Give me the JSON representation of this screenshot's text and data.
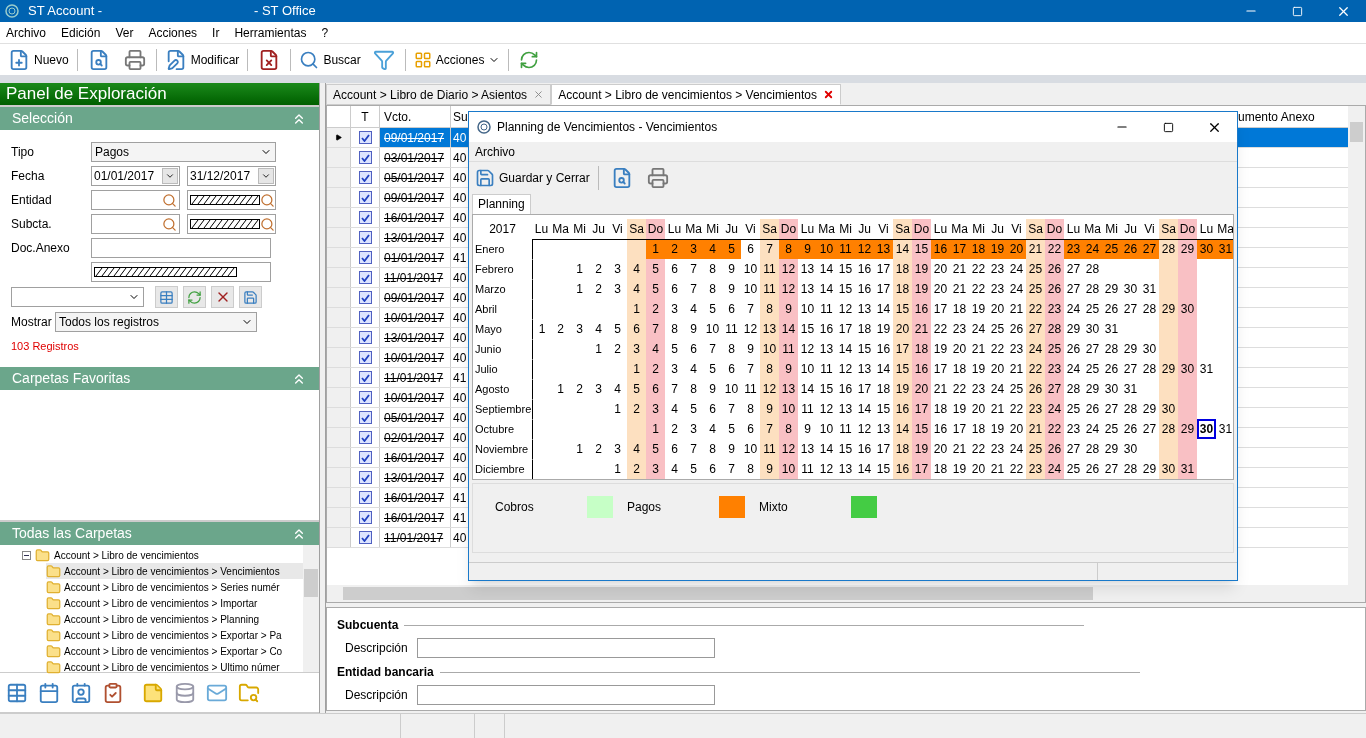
{
  "window": {
    "title_left": "ST Account -",
    "title_right": "- ST Office"
  },
  "menu": [
    "Archivo",
    "Edición",
    "Ver",
    "Acciones",
    "Ir",
    "Herramientas",
    "?"
  ],
  "toolbar": {
    "new": "Nuevo",
    "modify": "Modificar",
    "search": "Buscar",
    "actions": "Acciones"
  },
  "explorer": {
    "title": "Panel de Exploración",
    "selection": {
      "title": "Selección",
      "tipo": {
        "label": "Tipo",
        "value": "Pagos"
      },
      "fecha": {
        "label": "Fecha",
        "from": "01/01/2017",
        "to": "31/12/2017"
      },
      "entidad": {
        "label": "Entidad",
        "masked": true
      },
      "subcuenta": {
        "label": "Subcta.",
        "masked": true
      },
      "doc_anexo": {
        "label": "Doc.Anexo",
        "masked": true
      },
      "mostrar": {
        "label": "Mostrar",
        "value": "Todos los registros"
      },
      "count": "103 Registros"
    },
    "favorites": {
      "title": "Carpetas Favoritas"
    },
    "folders": {
      "title": "Todas las Carpetas",
      "tree": [
        {
          "label": "Account > Libro de vencimientos",
          "expanded": true,
          "selected": false,
          "children": [
            {
              "label": "Account > Libro de vencimientos > Vencimientos",
              "selected": true
            },
            {
              "label": "Account > Libro de vencimientos > Series numér",
              "selected": false
            },
            {
              "label": "Account > Libro de vencimientos > Importar",
              "selected": false
            },
            {
              "label": "Account > Libro de vencimientos > Planning",
              "selected": false
            },
            {
              "label": "Account > Libro de vencimientos > Exportar > Pa",
              "selected": false
            },
            {
              "label": "Account > Libro de vencimientos > Exportar > Co",
              "selected": false
            },
            {
              "label": "Account > Libro de vencimientos > Ultimo númer",
              "selected": false
            }
          ]
        }
      ]
    }
  },
  "tabs": [
    {
      "label": "Account > Libro de Diario > Asientos",
      "selected": false
    },
    {
      "label": "Account > Libro de vencimientos > Vencimientos",
      "selected": true
    }
  ],
  "table": {
    "columns": [
      "T",
      "Vcto.",
      "Su",
      "umento Anexo"
    ],
    "rows": [
      {
        "selected": true,
        "checked": true,
        "struck": true,
        "vcto": "09/01/2017",
        "su": "40"
      },
      {
        "selected": false,
        "checked": true,
        "struck": true,
        "vcto": "03/01/2017",
        "su": "40"
      },
      {
        "selected": false,
        "checked": true,
        "struck": true,
        "vcto": "05/01/2017",
        "su": "40"
      },
      {
        "selected": false,
        "checked": true,
        "struck": true,
        "vcto": "09/01/2017",
        "su": "40"
      },
      {
        "selected": false,
        "checked": true,
        "struck": true,
        "vcto": "16/01/2017",
        "su": "40"
      },
      {
        "selected": false,
        "checked": true,
        "struck": true,
        "vcto": "13/01/2017",
        "su": "40"
      },
      {
        "selected": false,
        "checked": true,
        "struck": true,
        "vcto": "01/01/2017",
        "su": "41"
      },
      {
        "selected": false,
        "checked": true,
        "struck": true,
        "vcto": "11/01/2017",
        "su": "40"
      },
      {
        "selected": false,
        "checked": true,
        "struck": true,
        "vcto": "09/01/2017",
        "su": "40"
      },
      {
        "selected": false,
        "checked": true,
        "struck": true,
        "vcto": "10/01/2017",
        "su": "40"
      },
      {
        "selected": false,
        "checked": true,
        "struck": true,
        "vcto": "13/01/2017",
        "su": "40"
      },
      {
        "selected": false,
        "checked": true,
        "struck": true,
        "vcto": "10/01/2017",
        "su": "40"
      },
      {
        "selected": false,
        "checked": true,
        "struck": true,
        "vcto": "11/01/2017",
        "su": "41"
      },
      {
        "selected": false,
        "checked": true,
        "struck": true,
        "vcto": "10/01/2017",
        "su": "40"
      },
      {
        "selected": false,
        "checked": true,
        "struck": true,
        "vcto": "05/01/2017",
        "su": "40"
      },
      {
        "selected": false,
        "checked": true,
        "struck": true,
        "vcto": "02/01/2017",
        "su": "40"
      },
      {
        "selected": false,
        "checked": true,
        "struck": true,
        "vcto": "16/01/2017",
        "su": "40"
      },
      {
        "selected": false,
        "checked": true,
        "struck": true,
        "vcto": "13/01/2017",
        "su": "40"
      },
      {
        "selected": false,
        "checked": true,
        "struck": true,
        "vcto": "16/01/2017",
        "su": "41"
      },
      {
        "selected": false,
        "checked": true,
        "struck": true,
        "vcto": "16/01/2017",
        "su": "41"
      },
      {
        "selected": false,
        "checked": true,
        "struck": true,
        "vcto": "11/01/2017",
        "su": "40"
      }
    ]
  },
  "details": [
    {
      "title": "Subcuenta",
      "label": "Descripción"
    },
    {
      "title": "Entidad bancaria",
      "label": "Descripción"
    }
  ],
  "dialog": {
    "title": "Planning de Vencimientos - Vencimientos",
    "menu": [
      "Archivo"
    ],
    "save": "Guardar y Cerrar",
    "tab": "Planning",
    "calendar": {
      "year": "2017",
      "weekdays": [
        {
          "label": "Lu",
          "kind": "work"
        },
        {
          "label": "Ma",
          "kind": "work"
        },
        {
          "label": "Mi",
          "kind": "work"
        },
        {
          "label": "Ju",
          "kind": "work"
        },
        {
          "label": "Vi",
          "kind": "work"
        },
        {
          "label": "Sa",
          "kind": "sat"
        },
        {
          "label": "Do",
          "kind": "sun"
        },
        {
          "label": "Lu",
          "kind": "work"
        },
        {
          "label": "Ma",
          "kind": "work"
        },
        {
          "label": "Mi",
          "kind": "work"
        },
        {
          "label": "Ju",
          "kind": "work"
        },
        {
          "label": "Vi",
          "kind": "work"
        },
        {
          "label": "Sa",
          "kind": "sat"
        },
        {
          "label": "Do",
          "kind": "sun"
        },
        {
          "label": "Lu",
          "kind": "work"
        },
        {
          "label": "Ma",
          "kind": "work"
        },
        {
          "label": "Mi",
          "kind": "work"
        },
        {
          "label": "Ju",
          "kind": "work"
        },
        {
          "label": "Vi",
          "kind": "work"
        },
        {
          "label": "Sa",
          "kind": "sat"
        },
        {
          "label": "Do",
          "kind": "sun"
        },
        {
          "label": "Lu",
          "kind": "work"
        },
        {
          "label": "Ma",
          "kind": "work"
        },
        {
          "label": "Mi",
          "kind": "work"
        },
        {
          "label": "Ju",
          "kind": "work"
        },
        {
          "label": "Vi",
          "kind": "work"
        },
        {
          "label": "Sa",
          "kind": "sat"
        },
        {
          "label": "Do",
          "kind": "sun"
        },
        {
          "label": "Lu",
          "kind": "work"
        },
        {
          "label": "Ma",
          "kind": "work"
        },
        {
          "label": "Mi",
          "kind": "work"
        },
        {
          "label": "Ju",
          "kind": "work"
        },
        {
          "label": "Vi",
          "kind": "work"
        },
        {
          "label": "Sa",
          "kind": "sat"
        },
        {
          "label": "Do",
          "kind": "sun"
        },
        {
          "label": "Lu",
          "kind": "work"
        },
        {
          "label": "Ma",
          "kind": "work"
        }
      ],
      "months": [
        {
          "name": "Enero",
          "kind": "sun",
          "days": [
            {
              "day": "1",
              "kind": "pagos",
              "selected": false
            },
            {
              "day": "2",
              "kind": "pagos",
              "selected": false
            },
            {
              "day": "3",
              "kind": "pagos",
              "selected": false
            },
            {
              "day": "4",
              "kind": "pagos",
              "selected": false
            },
            {
              "day": "5",
              "kind": "pagos",
              "selected": false
            },
            "6",
            "7",
            {
              "day": "8",
              "kind": "pagos",
              "selected": false
            },
            {
              "day": "9",
              "kind": "pagos",
              "selected": false
            },
            {
              "day": "10",
              "kind": "pagos",
              "selected": false
            },
            {
              "day": "11",
              "kind": "pagos",
              "selected": false
            },
            {
              "day": "12",
              "kind": "pagos",
              "selected": false
            },
            {
              "day": "13",
              "kind": "pagos",
              "selected": false
            },
            "14",
            "15",
            {
              "day": "16",
              "kind": "pagos",
              "selected": false
            },
            {
              "day": "17",
              "kind": "pagos",
              "selected": false
            },
            {
              "day": "18",
              "kind": "pagos",
              "selected": false
            },
            {
              "day": "19",
              "kind": "pagos",
              "selected": false
            },
            {
              "day": "20",
              "kind": "pagos",
              "selected": false
            },
            "21",
            "22",
            {
              "day": "23",
              "kind": "pagos",
              "selected": false
            },
            {
              "day": "24",
              "kind": "pagos",
              "selected": false
            },
            {
              "day": "25",
              "kind": "pagos",
              "selected": false
            },
            {
              "day": "26",
              "kind": "pagos",
              "selected": false
            },
            {
              "day": "27",
              "kind": "pagos",
              "selected": false
            },
            "28",
            "29",
            {
              "day": "30",
              "kind": "pagos",
              "selected": false
            },
            {
              "day": "31",
              "kind": "pagos",
              "selected": false
            }
          ]
        },
        {
          "name": "Febrero",
          "kind": "wed",
          "days": [
            "1",
            "2",
            "3",
            "4",
            "5",
            "6",
            "7",
            "8",
            "9",
            "10",
            "11",
            "12",
            "13",
            "14",
            "15",
            "16",
            "17",
            "18",
            "19",
            "20",
            "21",
            "22",
            "23",
            "24",
            "25",
            "26",
            "27",
            "28"
          ]
        },
        {
          "name": "Marzo",
          "kind": "wed",
          "days": [
            "1",
            "2",
            "3",
            "4",
            "5",
            "6",
            "7",
            "8",
            "9",
            "10",
            "11",
            "12",
            "13",
            "14",
            "15",
            "16",
            "17",
            "18",
            "19",
            "20",
            "21",
            "22",
            "23",
            "24",
            "25",
            "26",
            "27",
            "28",
            "29",
            "30",
            "31"
          ]
        },
        {
          "name": "Abril",
          "kind": "sat",
          "days": [
            "1",
            "2",
            "3",
            "4",
            "5",
            "6",
            "7",
            "8",
            "9",
            "10",
            "11",
            "12",
            "13",
            "14",
            "15",
            "16",
            "17",
            "18",
            "19",
            "20",
            "21",
            "22",
            "23",
            "24",
            "25",
            "26",
            "27",
            "28",
            "29",
            "30"
          ]
        },
        {
          "name": "Mayo",
          "kind": "mon",
          "days": [
            "1",
            "2",
            "3",
            "4",
            "5",
            "6",
            "7",
            "8",
            "9",
            "10",
            "11",
            "12",
            "13",
            "14",
            "15",
            "16",
            "17",
            "18",
            "19",
            "20",
            "21",
            "22",
            "23",
            "24",
            "25",
            "26",
            "27",
            "28",
            "29",
            "30",
            "31"
          ]
        },
        {
          "name": "Junio",
          "kind": "thu",
          "days": [
            "1",
            "2",
            "3",
            "4",
            "5",
            "6",
            "7",
            "8",
            "9",
            "10",
            "11",
            "12",
            "13",
            "14",
            "15",
            "16",
            "17",
            "18",
            "19",
            "20",
            "21",
            "22",
            "23",
            "24",
            "25",
            "26",
            "27",
            "28",
            "29",
            "30"
          ]
        },
        {
          "name": "Julio",
          "kind": "sat",
          "days": [
            "1",
            "2",
            "3",
            "4",
            "5",
            "6",
            "7",
            "8",
            "9",
            "10",
            "11",
            "12",
            "13",
            "14",
            "15",
            "16",
            "17",
            "18",
            "19",
            "20",
            "21",
            "22",
            "23",
            "24",
            "25",
            "26",
            "27",
            "28",
            "29",
            "30",
            "31"
          ]
        },
        {
          "name": "Agosto",
          "kind": "tue",
          "days": [
            "1",
            "2",
            "3",
            "4",
            "5",
            "6",
            "7",
            "8",
            "9",
            "10",
            "11",
            "12",
            "13",
            "14",
            "15",
            "16",
            "17",
            "18",
            "19",
            "20",
            "21",
            "22",
            "23",
            "24",
            "25",
            "26",
            "27",
            "28",
            "29",
            "30",
            "31"
          ]
        },
        {
          "name": "Septiembre",
          "kind": "fri",
          "days": [
            "1",
            "2",
            "3",
            "4",
            "5",
            "6",
            "7",
            "8",
            "9",
            "10",
            "11",
            "12",
            "13",
            "14",
            "15",
            "16",
            "17",
            "18",
            "19",
            "20",
            "21",
            "22",
            "23",
            "24",
            "25",
            "26",
            "27",
            "28",
            "29",
            "30"
          ]
        },
        {
          "name": "Octubre",
          "kind": "sun",
          "days": [
            "1",
            "2",
            "3",
            "4",
            "5",
            "6",
            "7",
            "8",
            "9",
            "10",
            "11",
            "12",
            "13",
            "14",
            "15",
            "16",
            "17",
            "18",
            "19",
            "20",
            "21",
            "22",
            "23",
            "24",
            "25",
            "26",
            "27",
            "28",
            "29",
            {
              "day": "30",
              "selected": true
            },
            "31"
          ]
        },
        {
          "name": "Noviembre",
          "kind": "wed",
          "days": [
            "1",
            "2",
            "3",
            "4",
            "5",
            "6",
            "7",
            "8",
            "9",
            "10",
            "11",
            "12",
            "13",
            "14",
            "15",
            "16",
            "17",
            "18",
            "19",
            "20",
            "21",
            "22",
            "23",
            "24",
            "25",
            "26",
            "27",
            "28",
            "29",
            "30"
          ]
        },
        {
          "name": "Diciembre",
          "kind": "fri",
          "days": [
            "1",
            "2",
            "3",
            "4",
            "5",
            "6",
            "7",
            "8",
            "9",
            "10",
            "11",
            "12",
            "13",
            "14",
            "15",
            "16",
            "17",
            "18",
            "19",
            "20",
            "21",
            "22",
            "23",
            "24",
            "25",
            "26",
            "27",
            "28",
            "29",
            "30",
            "31"
          ]
        }
      ]
    },
    "legend": [
      {
        "label": "Cobros",
        "kind": "cobros",
        "color": "#c6ffc6"
      },
      {
        "label": "Pagos",
        "kind": "pagos",
        "color": "#ff8000"
      },
      {
        "label": "Mixto",
        "kind": "mixto",
        "color": "#44cc44"
      }
    ]
  }
}
